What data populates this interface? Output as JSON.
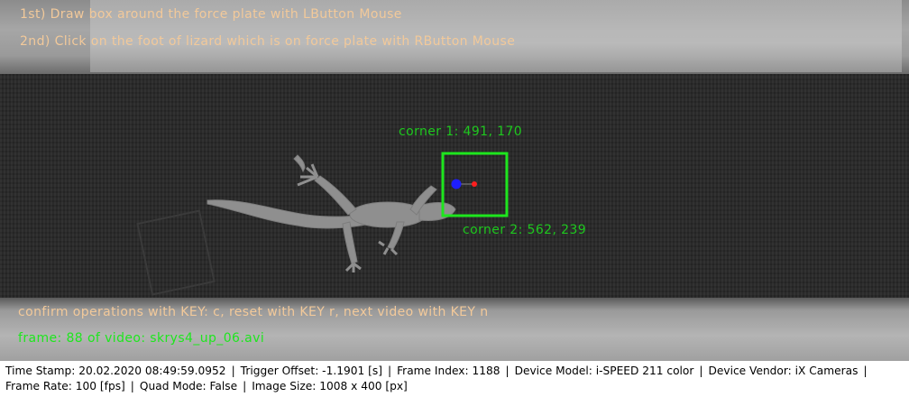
{
  "overlay": {
    "instruction_1": "1st) Draw box around the force plate with LButton Mouse",
    "instruction_2": "2nd) Click on the foot of lizard which is on force plate with RButton Mouse",
    "corner_1_label": "corner 1: 491, 170",
    "corner_2_label": "corner 2: 562, 239",
    "confirm_text": "confirm operations with KEY: c, reset with KEY r, next video with KEY n",
    "frame_info": "frame: 88 of video: skrys4_up_06.avi",
    "colors": {
      "instruction_text": "#f2c99a",
      "corner_text": "#1ec81e",
      "box": "#1ee61e",
      "confirm_text": "#f2c99a",
      "frame_text": "#1ee61e",
      "blue_marker": "#1e1eff",
      "red_marker": "#ff1e1e"
    }
  },
  "status_bar": {
    "time_stamp": "Time Stamp: 20.02.2020 08:49:59.0952",
    "trigger_offset": "Trigger Offset: -1.1901 [s]",
    "frame_index": "Frame Index: 1188",
    "device_model": "Device Model: i-SPEED 211 color",
    "device_vendor": "Device Vendor: iX Cameras",
    "frame_rate": "Frame Rate: 100 [fps]",
    "quad_mode": "Quad Mode: False",
    "image_size": "Image Size: 1008 x 400 [px]",
    "separator": "|"
  }
}
